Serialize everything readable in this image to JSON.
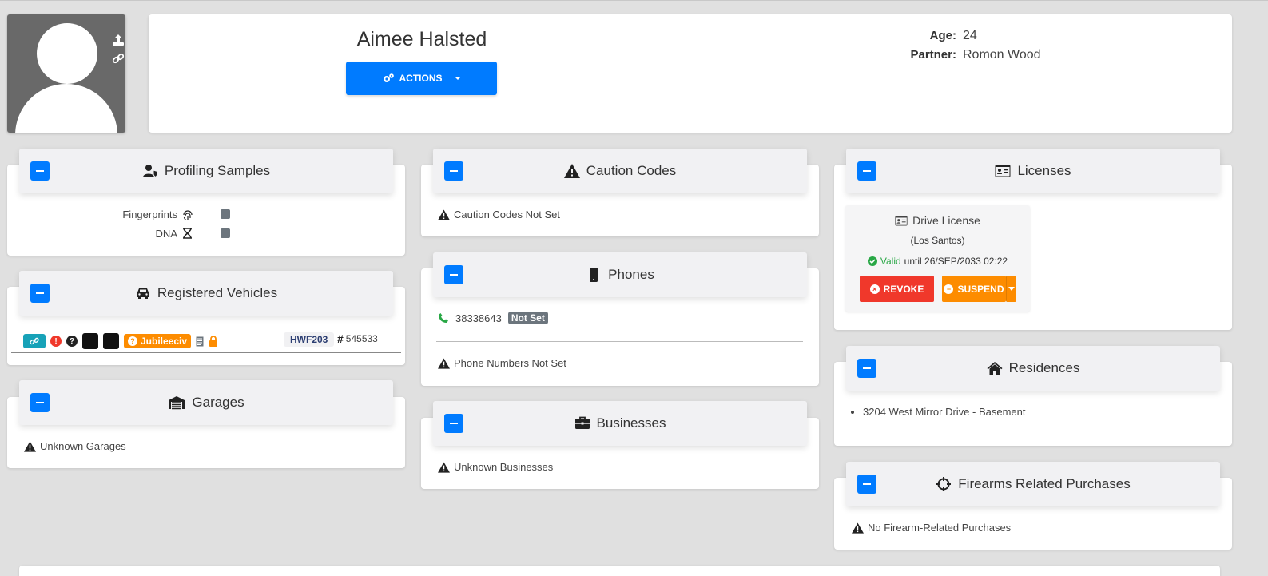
{
  "profile": {
    "name": "Aimee Halsted",
    "actions_label": "ACTIONS",
    "age_label": "Age:",
    "age_value": "24",
    "partner_label": "Partner:",
    "partner_value": "Romon Wood"
  },
  "profiling": {
    "title": "Profiling Samples",
    "fingerprints_label": "Fingerprints",
    "dna_label": "DNA"
  },
  "vehicles": {
    "title": "Registered Vehicles",
    "badge_label": "Jubileeciv",
    "plate": "HWF203",
    "number": "545533"
  },
  "garages": {
    "title": "Garages",
    "empty": "Unknown Garages"
  },
  "caution": {
    "title": "Caution Codes",
    "empty": "Caution Codes Not Set"
  },
  "phones": {
    "title": "Phones",
    "number": "38338643",
    "status_badge": "Not Set",
    "empty": "Phone Numbers Not Set"
  },
  "businesses": {
    "title": "Businesses",
    "empty": "Unknown Businesses"
  },
  "licenses": {
    "title": "Licenses",
    "license_name": "Drive License",
    "license_region": "(Los Santos)",
    "valid_label": "Valid",
    "valid_until": "until 26/SEP/2033 02:22",
    "revoke_label": "REVOKE",
    "suspend_label": "SUSPEND"
  },
  "residences": {
    "title": "Residences",
    "items": [
      "3204 West Mirror Drive - Basement"
    ]
  },
  "firearms": {
    "title": "Firearms Related Purchases",
    "empty": "No Firearm-Related Purchases"
  },
  "colors": {
    "primary": "#007bff",
    "info": "#17a2b8",
    "danger": "#f0382b",
    "warning": "#fd8c00",
    "success": "#28a745",
    "secondary": "#6c757d"
  }
}
